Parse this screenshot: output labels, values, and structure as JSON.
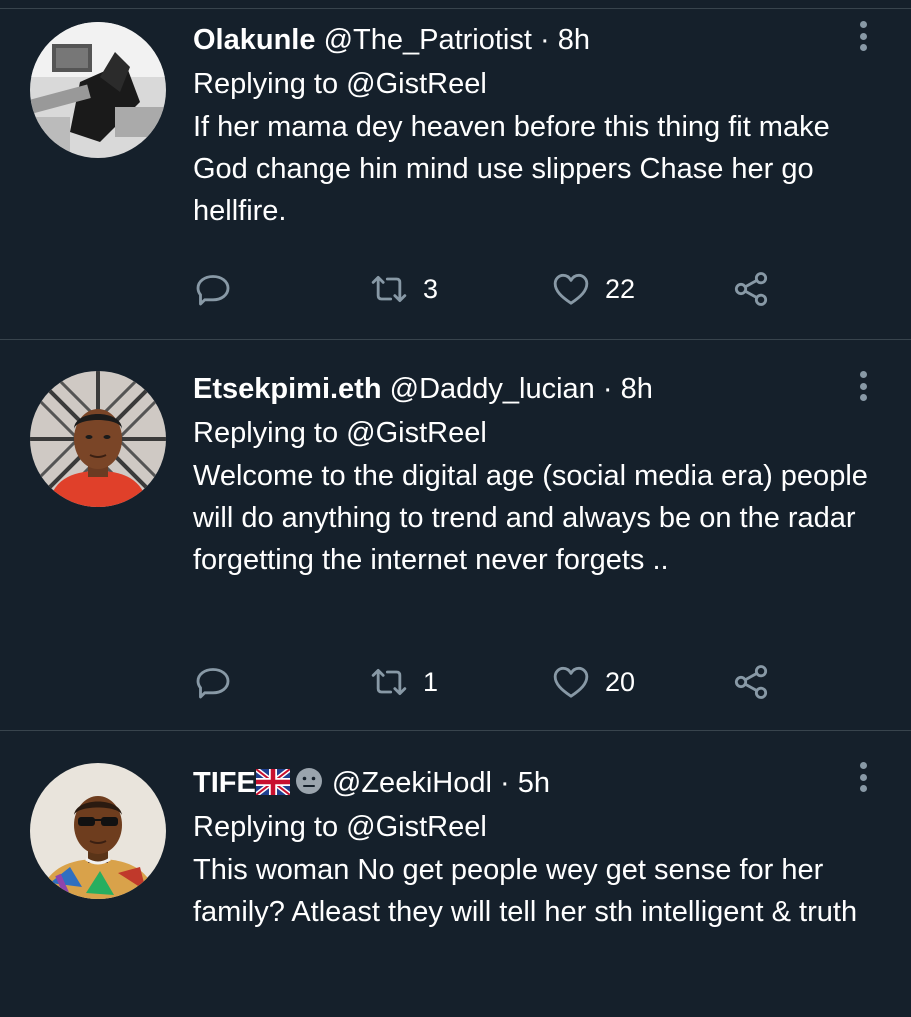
{
  "tweets": [
    {
      "name": "Olakunle",
      "handle": "@The_Patriotist",
      "separator": "·",
      "time": "8h",
      "replying_to": "Replying to @GistReel",
      "text": "If her mama dey heaven before this thing fit make God change hin mind use slippers Chase her go hellfire.",
      "retweets": "3",
      "likes": "22"
    },
    {
      "name": "Etsekpimi.eth",
      "handle": "@Daddy_lucian",
      "separator": "·",
      "time": "8h",
      "replying_to": "Replying to @GistReel",
      "text": "Welcome to the digital age (social media era) people will do anything to trend and always be on the radar forgetting the internet never forgets ..",
      "retweets": "1",
      "likes": "20"
    },
    {
      "name": "TIFE",
      "name_emojis": [
        "uk-flag-icon",
        "face-icon"
      ],
      "handle": "@ZeekiHodl",
      "separator": "·",
      "time": "5h",
      "replying_to": "Replying to @GistReel",
      "text": "This woman No get people wey get sense for her family? Atleast they will tell her sth intelligent & truth"
    }
  ],
  "colors": {
    "background": "#15202b",
    "divider": "#38444d",
    "icon": "#8899a6",
    "text": "#ffffff"
  },
  "icons": [
    "reply-icon",
    "retweet-icon",
    "like-icon",
    "share-icon",
    "more-options-icon"
  ]
}
